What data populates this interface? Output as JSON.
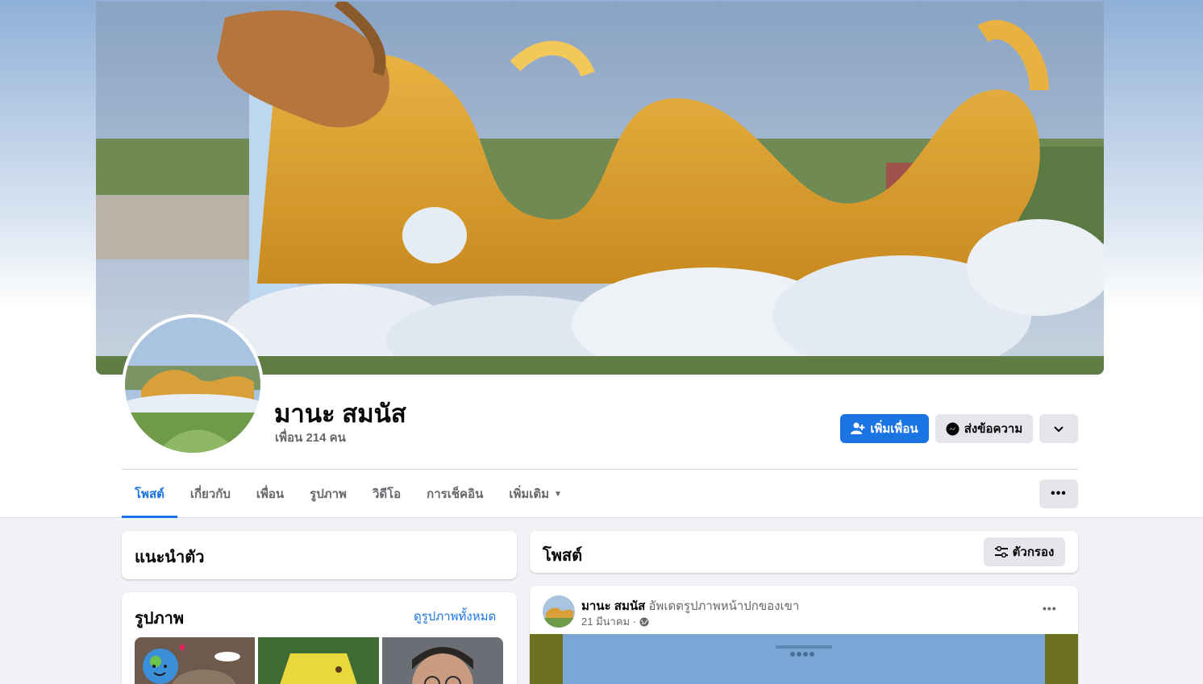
{
  "profile": {
    "name": "มานะ สมนัส",
    "friends_text": "เพื่อน 214 คน"
  },
  "actions": {
    "add_friend": "เพิ่มเพื่อน",
    "message": "ส่งข้อความ"
  },
  "tabs": [
    {
      "label": "โพสต์",
      "active": true
    },
    {
      "label": "เกี่ยวกับ"
    },
    {
      "label": "เพื่อน"
    },
    {
      "label": "รูปภาพ"
    },
    {
      "label": "วิดีโอ"
    },
    {
      "label": "การเช็คอิน"
    },
    {
      "label": "เพิ่มเติม"
    }
  ],
  "intro": {
    "title": "แนะนำตัว"
  },
  "photos": {
    "title": "รูปภาพ",
    "see_all": "ดูรูปภาพทั้งหมด"
  },
  "posts": {
    "title": "โพสต์",
    "filter_label": "ตัวกรอง"
  },
  "post": {
    "author": "มานะ สมนัส",
    "action": "อัพเดตรูปภาพหน้าปกของเขา",
    "date": "21 มีนาคม ·"
  },
  "colors": {
    "accent": "#1b74e4",
    "button_gray": "#e4e6eb",
    "secondary_text": "#65676b"
  }
}
